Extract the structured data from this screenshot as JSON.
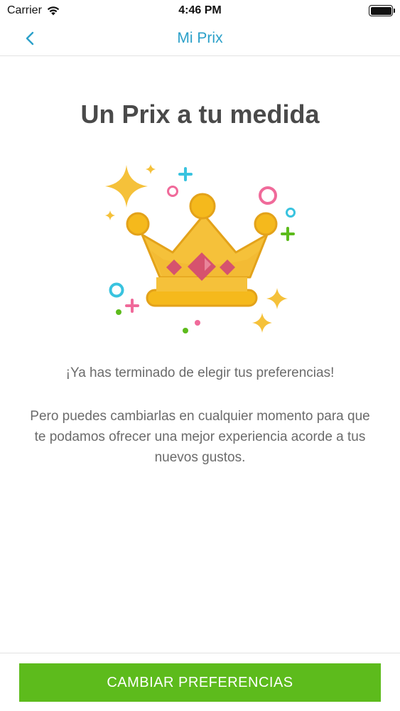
{
  "status_bar": {
    "carrier": "Carrier",
    "time": "4:46 PM"
  },
  "nav": {
    "title": "Mi Prix",
    "back_icon": "chevron-left-icon"
  },
  "main": {
    "title": "Un Prix a tu medida",
    "illustration": "crown-icon",
    "message": "¡Ya has terminado de elegir tus preferencias!",
    "description": "Pero puedes cambiarlas en cualquier momento para que te podamos ofrecer una mejor experiencia acorde a tus nuevos gustos."
  },
  "footer": {
    "button_label": "CAMBIAR PREFERENCIAS"
  },
  "colors": {
    "accent": "#2ba0c9",
    "button": "#5dbb1c",
    "crown": "#f5c13a",
    "gem": "#d6526e"
  }
}
